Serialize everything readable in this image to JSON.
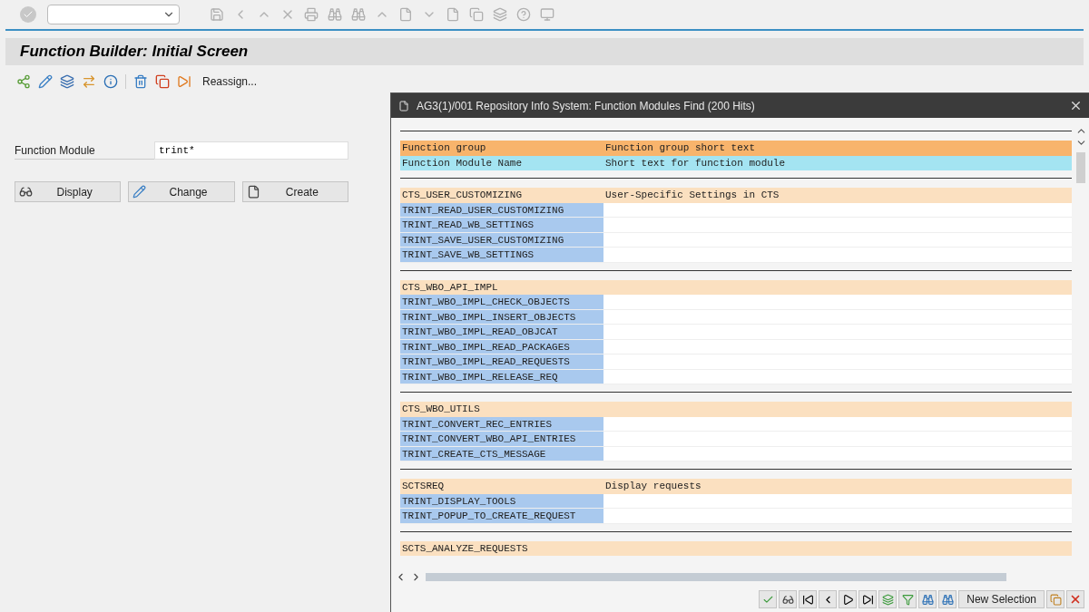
{
  "screen": {
    "title": "Function Builder: Initial Screen"
  },
  "app_toolbar": {
    "reassign": "Reassign..."
  },
  "form": {
    "label": "Function Module",
    "value": "trint*",
    "buttons": [
      {
        "kind": "display",
        "label": "Display"
      },
      {
        "kind": "change",
        "label": "Change"
      },
      {
        "kind": "create",
        "label": "Create"
      }
    ]
  },
  "dialog": {
    "title": "AG3(1)/001 Repository Info System: Function Modules Find (200 Hits)",
    "header_rows": [
      {
        "kind": "group",
        "col1": "Function group",
        "col2": "Function group short text"
      },
      {
        "kind": "module",
        "col1": "Function Module Name",
        "col2": "Short text for function module"
      }
    ],
    "groups": [
      {
        "name": "CTS_USER_CUSTOMIZING",
        "text": "User-Specific Settings in CTS",
        "modules": [
          "TRINT_READ_USER_CUSTOMIZING",
          "TRINT_READ_WB_SETTINGS",
          "TRINT_SAVE_USER_CUSTOMIZING",
          "TRINT_SAVE_WB_SETTINGS"
        ]
      },
      {
        "name": "CTS_WBO_API_IMPL",
        "modules": [
          "TRINT_WBO_IMPL_CHECK_OBJECTS",
          "TRINT_WBO_IMPL_INSERT_OBJECTS",
          "TRINT_WBO_IMPL_READ_OBJCAT",
          "TRINT_WBO_IMPL_READ_PACKAGES",
          "TRINT_WBO_IMPL_READ_REQUESTS",
          "TRINT_WBO_IMPL_RELEASE_REQ"
        ]
      },
      {
        "name": "CTS_WBO_UTILS",
        "modules": [
          "TRINT_CONVERT_REC_ENTRIES",
          "TRINT_CONVERT_WBO_API_ENTRIES",
          "TRINT_CREATE_CTS_MESSAGE"
        ]
      },
      {
        "name": "SCTSREQ",
        "text": "Display requests",
        "modules": [
          "TRINT_DISPLAY_TOOLS",
          "TRINT_POPUP_TO_CREATE_REQUEST"
        ]
      },
      {
        "name": "SCTS_ANALYZE_REQUESTS"
      }
    ],
    "footer_button": "New Selection"
  }
}
